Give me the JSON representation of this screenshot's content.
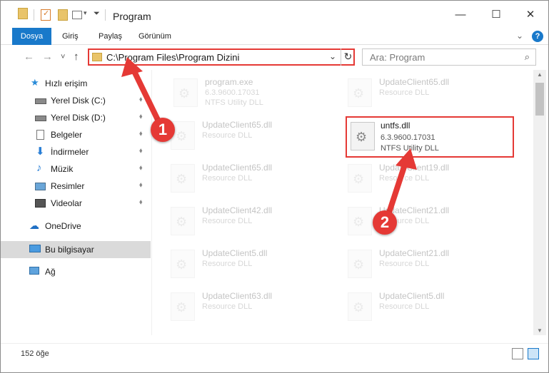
{
  "window": {
    "title": "Program",
    "controls": {
      "minimize": "—",
      "maximize": "☐",
      "close": "✕"
    }
  },
  "ribbon": {
    "tabs": [
      "Dosya",
      "Giriş",
      "Paylaş",
      "Görünüm"
    ],
    "expand": "⌄",
    "help": "?"
  },
  "nav": {
    "back": "←",
    "forward": "→",
    "recent": "˅",
    "up": "↑",
    "address": "C:\\Program Files\\Program Dizini",
    "address_dropdown": "⌄",
    "refresh": "↻",
    "search_placeholder": "Ara: Program",
    "search_icon": "⌕"
  },
  "sidebar": {
    "items": [
      {
        "label": "Hızlı erişim",
        "icon": "star-icon",
        "pinned": false
      },
      {
        "label": "Yerel Disk (C:)",
        "icon": "drive-icon",
        "pinned": true
      },
      {
        "label": "Yerel Disk (D:)",
        "icon": "drive-icon",
        "pinned": true
      },
      {
        "label": "Belgeler",
        "icon": "documents-icon",
        "pinned": true
      },
      {
        "label": "İndirmeler",
        "icon": "download-icon",
        "pinned": true
      },
      {
        "label": "Müzik",
        "icon": "music-icon",
        "pinned": true
      },
      {
        "label": "Resimler",
        "icon": "pictures-icon",
        "pinned": true
      },
      {
        "label": "Videolar",
        "icon": "videos-icon",
        "pinned": true
      },
      {
        "label": "OneDrive",
        "icon": "cloud-icon",
        "pinned": false
      },
      {
        "label": "Bu bilgisayar",
        "icon": "computer-icon",
        "pinned": false
      },
      {
        "label": "Ağ",
        "icon": "network-icon",
        "pinned": false
      }
    ],
    "pin_glyph": "📌"
  },
  "files": {
    "left": [
      {
        "name": "program.exe",
        "line1": "6.3.9600.17031",
        "line2": "NTFS Utility DLL"
      },
      {
        "name": "UpdateClient65.dll",
        "line1": "Resource DLL"
      },
      {
        "name": "UpdateClient65.dll",
        "line1": "Resource DLL"
      },
      {
        "name": "UpdateClient42.dll",
        "line1": "Resource DLL"
      },
      {
        "name": "UpdateClient5.dll",
        "line1": "Resource DLL"
      },
      {
        "name": "UpdateClient63.dll",
        "line1": "Resource DLL"
      }
    ],
    "right": [
      {
        "name": "UpdateClient65.dll",
        "line1": "Resource DLL"
      },
      {
        "name": "UpdateClient19.dll",
        "line1": "Resource DLL"
      },
      {
        "name": "UpdateClient21.dll",
        "line1": "Resource DLL"
      },
      {
        "name": "UpdateClient21.dll",
        "line1": "Resource DLL"
      },
      {
        "name": "UpdateClient5.dll",
        "line1": "Resource DLL"
      }
    ],
    "highlighted": {
      "name": "untfs.dll",
      "line1": "6.3.9600.17031",
      "line2": "NTFS Utility DLL"
    }
  },
  "annotations": {
    "step1": "1",
    "step2": "2",
    "color": "#e53935"
  },
  "status": {
    "count": "152 öğe"
  }
}
